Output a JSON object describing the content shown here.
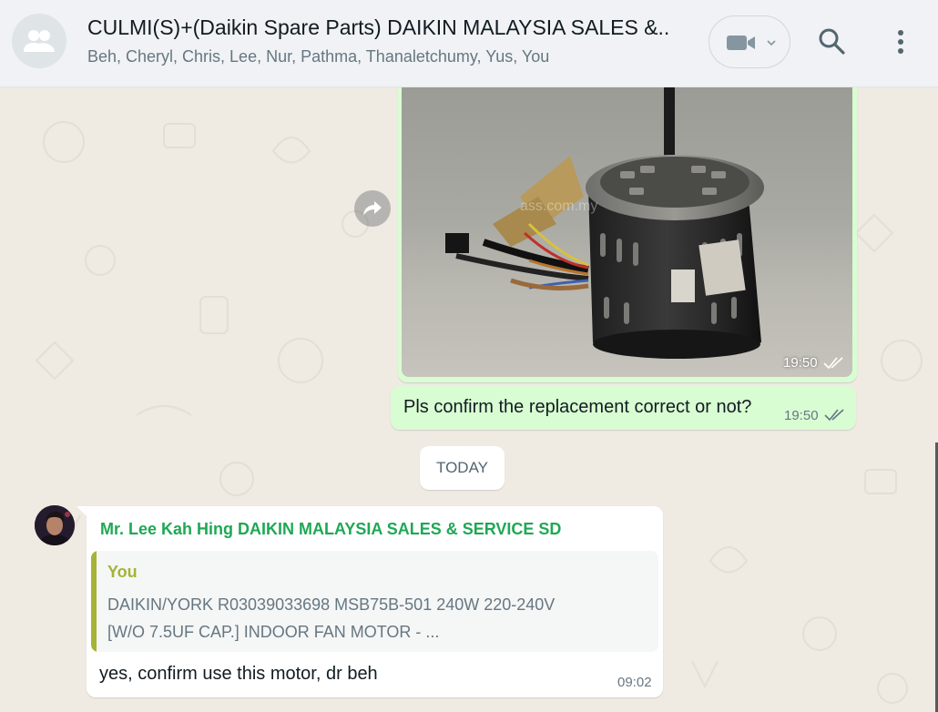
{
  "header": {
    "title": "CULMI(S)+(Daikin Spare Parts) DAIKIN MALAYSIA SALES &...",
    "participants": "Beh, Cheryl, Chris, Lee, Nur, Pathma, Thanaletchumy, Yus, You",
    "icons": [
      "group-avatar-icon",
      "video-call-icon",
      "chevron-down-icon",
      "search-icon",
      "more-options-icon"
    ]
  },
  "messages": {
    "image_message": {
      "time": "19:50",
      "status": "read",
      "watermark": "ass.com.my"
    },
    "text_message": {
      "text": "Pls confirm the replacement correct or not?",
      "time": "19:50",
      "status": "read"
    },
    "date_separator": "TODAY",
    "incoming": {
      "sender": "Mr. Lee Kah Hing DAIKIN MALAYSIA SALES & SERVICE SD",
      "quote_author": "You",
      "quote_text": "DAIKIN/YORK R03039033698 MSB75B-501 240W 220-240V [W/O 7.5UF CAP.] INDOOR FAN MOTOR - ...",
      "text": "yes, confirm use this motor, dr beh",
      "time": "09:02"
    }
  },
  "colors": {
    "outgoing_bubble": "#d9fdd3",
    "incoming_bubble": "#ffffff",
    "sender_name": "#1fa855",
    "quote_accent": "#a5b337",
    "read_tick": "#667781",
    "chat_background": "#efeae2"
  }
}
